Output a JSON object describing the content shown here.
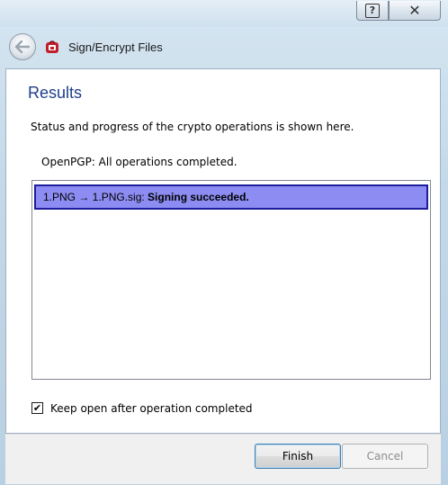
{
  "titlebar": {
    "help_icon": "question-mark-icon",
    "help_glyph": "?",
    "close_icon": "close-icon",
    "close_glyph": "✕"
  },
  "nav": {
    "back_icon": "back-arrow-icon",
    "app_icon": "kleopatra-icon",
    "title": "Sign/Encrypt Files"
  },
  "page": {
    "heading": "Results",
    "status_text": "Status and progress of the crypto operations is shown here.",
    "openpgp_text": "OpenPGP: All operations completed."
  },
  "results_list": {
    "items": [
      {
        "operation": "1.PNG → 1.PNG.sig: ",
        "result": "Signing succeeded."
      }
    ],
    "selected_color": "#8c8cf2"
  },
  "options": {
    "keep_open_checked": true,
    "keep_open_label": "Keep open after operation completed",
    "check_glyph": "✔"
  },
  "buttons": {
    "finish_label": "Finish",
    "cancel_label": "Cancel"
  },
  "colors": {
    "heading": "#1e3f8a",
    "selection_border": "#1c1c9c"
  }
}
